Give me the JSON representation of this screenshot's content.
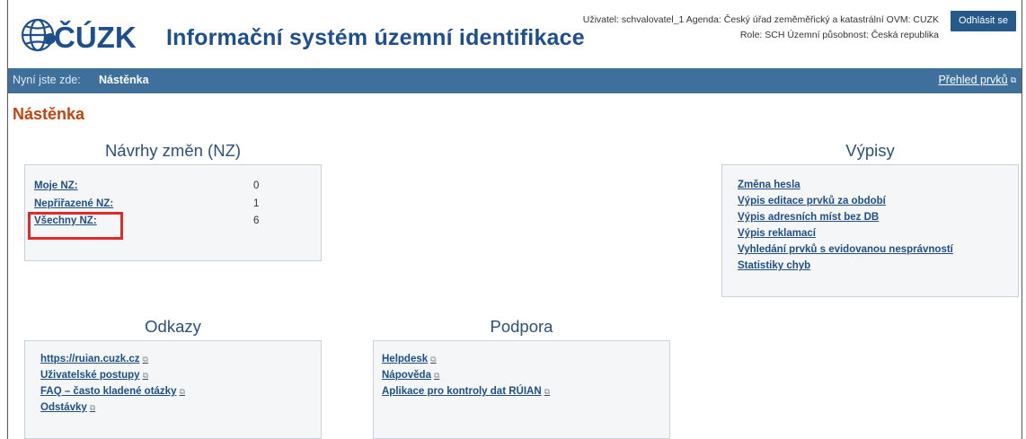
{
  "header": {
    "logo_text": "ČÚZK",
    "app_title": "Informační systém územní identifikace",
    "user_line1": "Uživatel: schvalovatel_1   Agenda: Český úřad zeměměřický a katastrální   OVM: CUZK",
    "user_line2": "Role: SCH   Územní působnost: Česká republika",
    "logout_label": "Odhlásit se"
  },
  "navbar": {
    "crumb_label": "Nyní jste zde:",
    "crumb_current": "Nástěnka",
    "overview_link": "Přehled prvků"
  },
  "page_title": "Nástěnka",
  "nz": {
    "title": "Návrhy změn (NZ)",
    "rows": [
      {
        "label": "Moje NZ:",
        "value": "0"
      },
      {
        "label": "Nepřiřazené NZ:",
        "value": "1"
      },
      {
        "label": "Všechny NZ:",
        "value": "6"
      }
    ]
  },
  "vypisy": {
    "title": "Výpisy",
    "links": [
      "Změna hesla",
      "Výpis editace prvků za období",
      "Výpis adresních míst bez DB",
      "Výpis reklamací",
      "Vyhledání prvků s evidovanou nesprávností",
      "Statistiky chyb"
    ]
  },
  "odkazy": {
    "title": "Odkazy",
    "links": [
      "https://ruian.cuzk.cz",
      "Uživatelské postupy",
      "FAQ – často kladené otázky",
      "Odstávky"
    ]
  },
  "podpora": {
    "title": "Podpora",
    "links": [
      "Helpdesk",
      "Nápověda",
      "Aplikace pro kontroly dat RÚIAN"
    ]
  },
  "colors": {
    "brand_blue": "#1d4e8d",
    "navbar": "#3f6f9b",
    "title_orange": "#c1440e",
    "highlight_red": "#e02a2a"
  },
  "icons": [
    "cuzk-logo",
    "external-link-icon"
  ]
}
